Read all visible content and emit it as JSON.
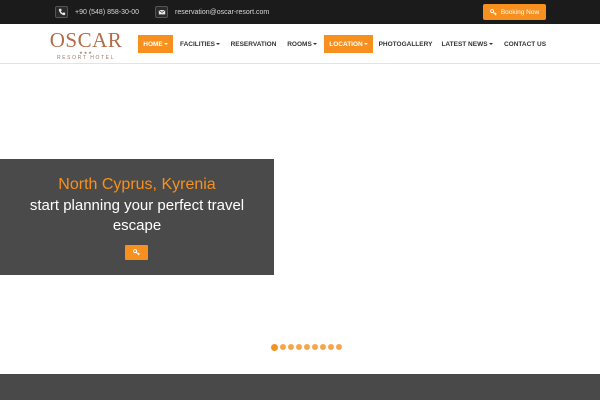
{
  "topbar": {
    "phone": "+90 (548) 858-30-00",
    "phone_icon": "phone-icon",
    "email": "reservation@oscar-resort.com",
    "email_icon": "envelope-icon",
    "booking_label": "Booking Now",
    "booking_icon": "key-icon"
  },
  "logo": {
    "name": "OSCAR",
    "stars": "★★★",
    "subtitle": "RESORT HOTEL"
  },
  "nav": {
    "items": [
      {
        "label": "HOME",
        "dropdown": true,
        "active": true
      },
      {
        "label": "FACILITIES",
        "dropdown": true,
        "active": false
      },
      {
        "label": "RESERVATION",
        "dropdown": false,
        "active": false
      },
      {
        "label": "ROOMS",
        "dropdown": true,
        "active": false
      },
      {
        "label": "LOCATION",
        "dropdown": true,
        "active": true
      },
      {
        "label": "PHOTOGALLERY",
        "dropdown": false,
        "active": false
      },
      {
        "label": "LATEST NEWS",
        "dropdown": true,
        "active": false
      },
      {
        "label": "CONTACT US",
        "dropdown": false,
        "active": false
      }
    ]
  },
  "hero": {
    "title": "North Cyprus, Kyrenia",
    "subtitle_line1": "start planning your perfect travel",
    "subtitle_line2": "escape",
    "button_icon": "key-icon",
    "slide_count": 9,
    "active_slide": 1
  },
  "colors": {
    "accent": "#f7901e",
    "topbar_bg": "#1b1b1b",
    "caption_bg": "#4a4a4a",
    "logo": "#b56c4a",
    "band_bg": "#494949"
  }
}
